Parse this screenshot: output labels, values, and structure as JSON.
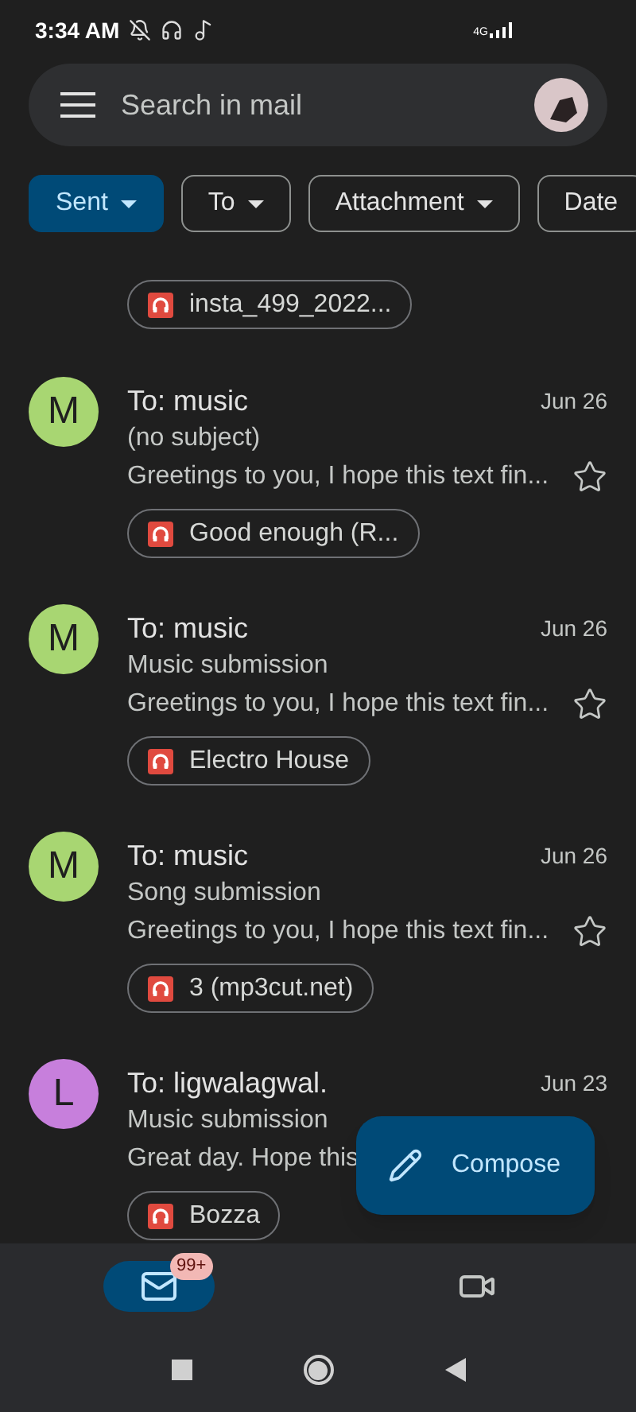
{
  "status_bar": {
    "time": "3:34 AM",
    "network": "4G"
  },
  "search": {
    "placeholder": "Search in mail"
  },
  "filters": [
    {
      "label": "Sent",
      "selected": true,
      "dropdown": true
    },
    {
      "label": "To",
      "selected": false,
      "dropdown": true
    },
    {
      "label": "Attachment",
      "selected": false,
      "dropdown": true
    },
    {
      "label": "Date",
      "selected": false,
      "dropdown": false
    }
  ],
  "partial_email": {
    "attachment": "insta_499_2022..."
  },
  "emails": [
    {
      "avatar": "M",
      "color": "#a8d672",
      "recipient": "To: music",
      "date": "Jun 26",
      "subject": "(no subject)",
      "snippet": "Greetings to you, I hope this text fin...",
      "starred": false,
      "attachment": "Good enough (R..."
    },
    {
      "avatar": "M",
      "color": "#a8d672",
      "recipient": "To: music",
      "date": "Jun 26",
      "subject": "Music submission",
      "snippet": "Greetings to you, I hope this text fin...",
      "starred": false,
      "attachment": "Electro House"
    },
    {
      "avatar": "M",
      "color": "#a8d672",
      "recipient": "To: music",
      "date": "Jun 26",
      "subject": "Song submission",
      "snippet": "Greetings to you, I hope this text fin...",
      "starred": false,
      "attachment": "3 (mp3cut.net)"
    },
    {
      "avatar": "L",
      "color": "#c77fdc",
      "recipient": "To: ligwalagwal.",
      "date": "Jun 23",
      "subject": "Music submission",
      "snippet": "Great day. Hope this",
      "attachment": "Bozza"
    }
  ],
  "compose": {
    "label": "Compose"
  },
  "bottom_nav": [
    {
      "kind": "mail",
      "selected": true,
      "badge": "99+"
    },
    {
      "kind": "video",
      "selected": false
    }
  ]
}
